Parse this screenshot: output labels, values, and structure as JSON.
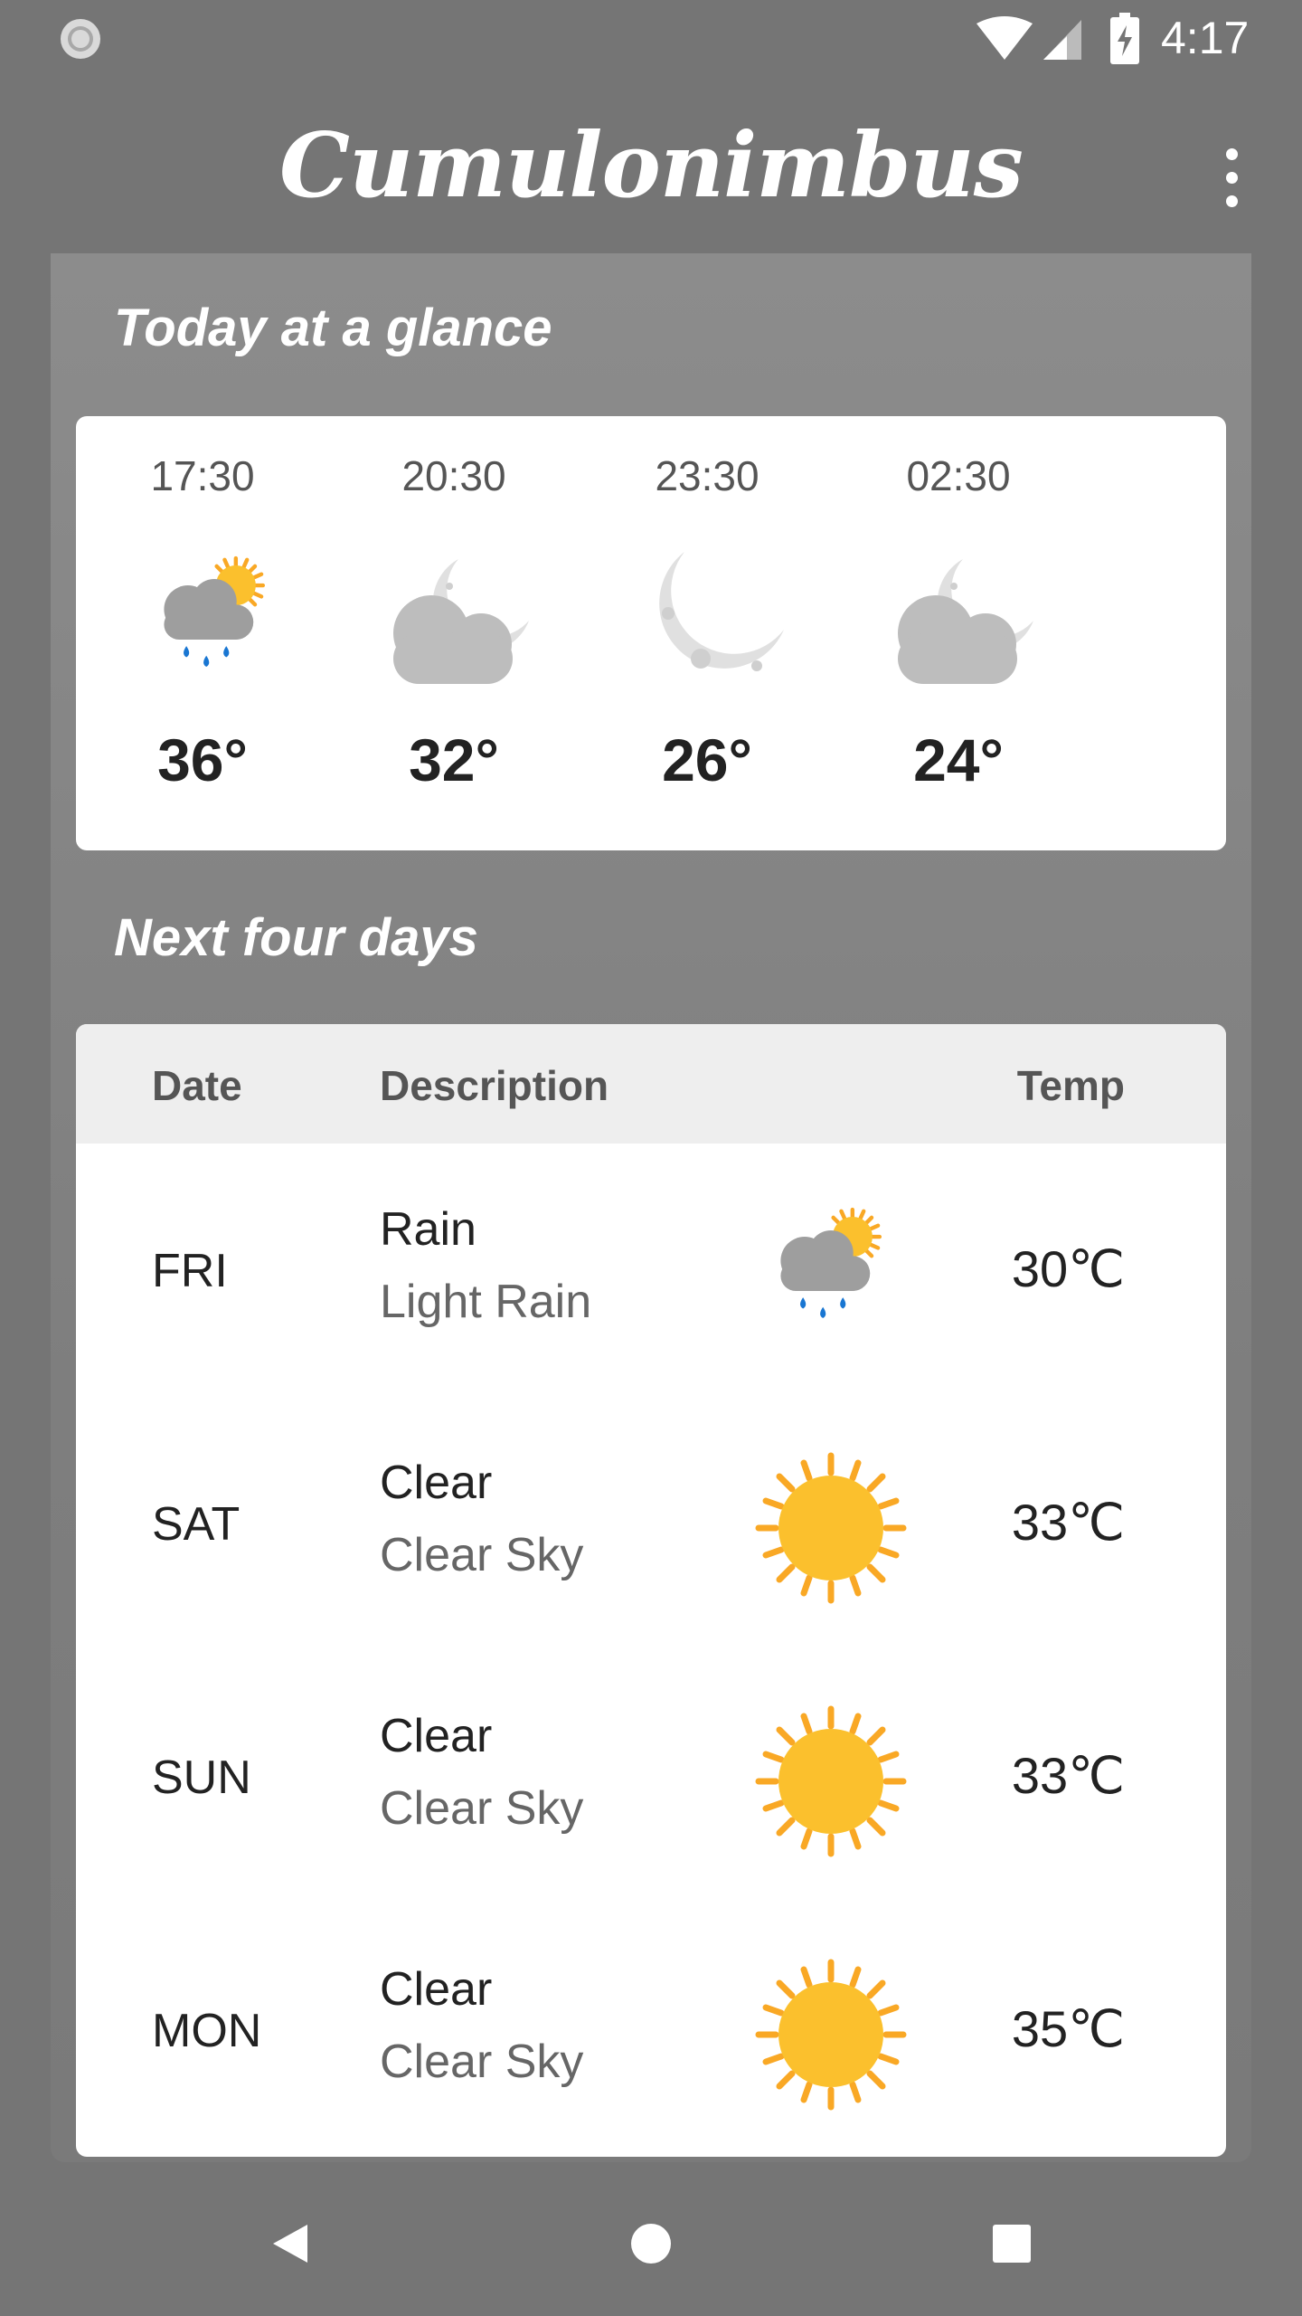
{
  "status_bar": {
    "time": "4:17",
    "icons": [
      "sync-icon",
      "wifi-icon",
      "signal-icon",
      "battery-charging-icon"
    ]
  },
  "app_bar": {
    "title": "Cumulonimbus",
    "menu_icon": "overflow-menu-icon"
  },
  "today": {
    "title": "Today at a glance",
    "hours": [
      {
        "time": "17:30",
        "temp": "36°",
        "icon": "sun-cloud-rain-icon"
      },
      {
        "time": "20:30",
        "temp": "32°",
        "icon": "moon-cloud-icon"
      },
      {
        "time": "23:30",
        "temp": "26°",
        "icon": "moon-icon"
      },
      {
        "time": "02:30",
        "temp": "24°",
        "icon": "moon-cloud-icon"
      }
    ]
  },
  "forecast": {
    "title": "Next four days",
    "columns": {
      "date": "Date",
      "description": "Description",
      "temp": "Temp"
    },
    "days": [
      {
        "day": "FRI",
        "main": "Rain",
        "desc": "Light Rain",
        "temp": "30℃",
        "icon": "sun-cloud-rain-icon"
      },
      {
        "day": "SAT",
        "main": "Clear",
        "desc": "Clear Sky",
        "temp": "33℃",
        "icon": "sun-icon"
      },
      {
        "day": "SUN",
        "main": "Clear",
        "desc": "Clear Sky",
        "temp": "33℃",
        "icon": "sun-icon"
      },
      {
        "day": "MON",
        "main": "Clear",
        "desc": "Clear Sky",
        "temp": "35℃",
        "icon": "sun-icon"
      }
    ]
  },
  "nav_bar": {
    "icons": [
      "back-icon",
      "home-icon",
      "recents-icon"
    ]
  },
  "colors": {
    "background": "#757575",
    "panel": "#8a8a8a",
    "sun": "#fbc02d",
    "sun_ray": "#f9a825",
    "cloud": "#9e9e9e",
    "cloud_light": "#bdbdbd",
    "moon": "#e0e0e0",
    "rain": "#1976d2"
  }
}
